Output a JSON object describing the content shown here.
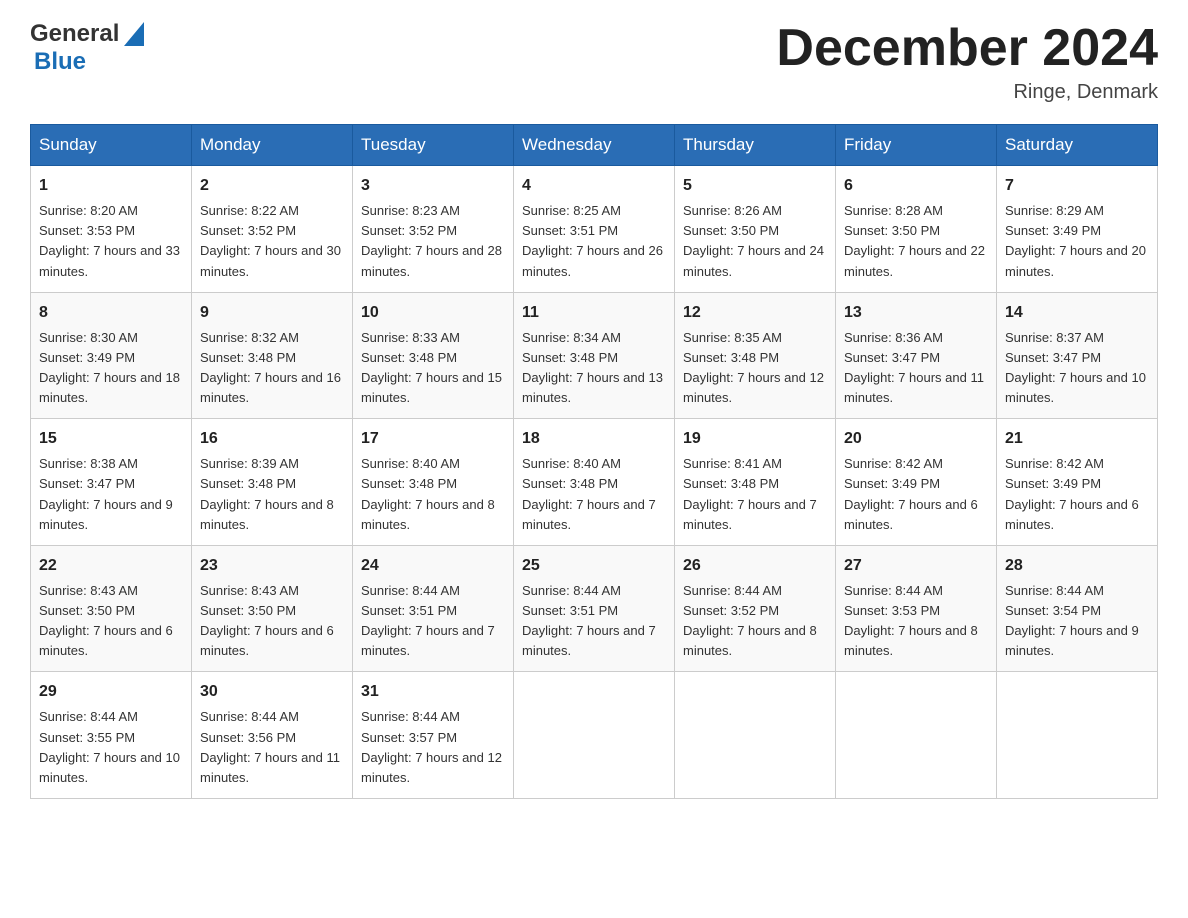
{
  "logo": {
    "text_general": "General",
    "text_blue": "Blue",
    "triangle_symbol": "▲"
  },
  "header": {
    "month_year": "December 2024",
    "location": "Ringe, Denmark"
  },
  "days_of_week": [
    "Sunday",
    "Monday",
    "Tuesday",
    "Wednesday",
    "Thursday",
    "Friday",
    "Saturday"
  ],
  "weeks": [
    [
      {
        "day": "1",
        "sunrise": "8:20 AM",
        "sunset": "3:53 PM",
        "daylight": "7 hours and 33 minutes."
      },
      {
        "day": "2",
        "sunrise": "8:22 AM",
        "sunset": "3:52 PM",
        "daylight": "7 hours and 30 minutes."
      },
      {
        "day": "3",
        "sunrise": "8:23 AM",
        "sunset": "3:52 PM",
        "daylight": "7 hours and 28 minutes."
      },
      {
        "day": "4",
        "sunrise": "8:25 AM",
        "sunset": "3:51 PM",
        "daylight": "7 hours and 26 minutes."
      },
      {
        "day": "5",
        "sunrise": "8:26 AM",
        "sunset": "3:50 PM",
        "daylight": "7 hours and 24 minutes."
      },
      {
        "day": "6",
        "sunrise": "8:28 AM",
        "sunset": "3:50 PM",
        "daylight": "7 hours and 22 minutes."
      },
      {
        "day": "7",
        "sunrise": "8:29 AM",
        "sunset": "3:49 PM",
        "daylight": "7 hours and 20 minutes."
      }
    ],
    [
      {
        "day": "8",
        "sunrise": "8:30 AM",
        "sunset": "3:49 PM",
        "daylight": "7 hours and 18 minutes."
      },
      {
        "day": "9",
        "sunrise": "8:32 AM",
        "sunset": "3:48 PM",
        "daylight": "7 hours and 16 minutes."
      },
      {
        "day": "10",
        "sunrise": "8:33 AM",
        "sunset": "3:48 PM",
        "daylight": "7 hours and 15 minutes."
      },
      {
        "day": "11",
        "sunrise": "8:34 AM",
        "sunset": "3:48 PM",
        "daylight": "7 hours and 13 minutes."
      },
      {
        "day": "12",
        "sunrise": "8:35 AM",
        "sunset": "3:48 PM",
        "daylight": "7 hours and 12 minutes."
      },
      {
        "day": "13",
        "sunrise": "8:36 AM",
        "sunset": "3:47 PM",
        "daylight": "7 hours and 11 minutes."
      },
      {
        "day": "14",
        "sunrise": "8:37 AM",
        "sunset": "3:47 PM",
        "daylight": "7 hours and 10 minutes."
      }
    ],
    [
      {
        "day": "15",
        "sunrise": "8:38 AM",
        "sunset": "3:47 PM",
        "daylight": "7 hours and 9 minutes."
      },
      {
        "day": "16",
        "sunrise": "8:39 AM",
        "sunset": "3:48 PM",
        "daylight": "7 hours and 8 minutes."
      },
      {
        "day": "17",
        "sunrise": "8:40 AM",
        "sunset": "3:48 PM",
        "daylight": "7 hours and 8 minutes."
      },
      {
        "day": "18",
        "sunrise": "8:40 AM",
        "sunset": "3:48 PM",
        "daylight": "7 hours and 7 minutes."
      },
      {
        "day": "19",
        "sunrise": "8:41 AM",
        "sunset": "3:48 PM",
        "daylight": "7 hours and 7 minutes."
      },
      {
        "day": "20",
        "sunrise": "8:42 AM",
        "sunset": "3:49 PM",
        "daylight": "7 hours and 6 minutes."
      },
      {
        "day": "21",
        "sunrise": "8:42 AM",
        "sunset": "3:49 PM",
        "daylight": "7 hours and 6 minutes."
      }
    ],
    [
      {
        "day": "22",
        "sunrise": "8:43 AM",
        "sunset": "3:50 PM",
        "daylight": "7 hours and 6 minutes."
      },
      {
        "day": "23",
        "sunrise": "8:43 AM",
        "sunset": "3:50 PM",
        "daylight": "7 hours and 6 minutes."
      },
      {
        "day": "24",
        "sunrise": "8:44 AM",
        "sunset": "3:51 PM",
        "daylight": "7 hours and 7 minutes."
      },
      {
        "day": "25",
        "sunrise": "8:44 AM",
        "sunset": "3:51 PM",
        "daylight": "7 hours and 7 minutes."
      },
      {
        "day": "26",
        "sunrise": "8:44 AM",
        "sunset": "3:52 PM",
        "daylight": "7 hours and 8 minutes."
      },
      {
        "day": "27",
        "sunrise": "8:44 AM",
        "sunset": "3:53 PM",
        "daylight": "7 hours and 8 minutes."
      },
      {
        "day": "28",
        "sunrise": "8:44 AM",
        "sunset": "3:54 PM",
        "daylight": "7 hours and 9 minutes."
      }
    ],
    [
      {
        "day": "29",
        "sunrise": "8:44 AM",
        "sunset": "3:55 PM",
        "daylight": "7 hours and 10 minutes."
      },
      {
        "day": "30",
        "sunrise": "8:44 AM",
        "sunset": "3:56 PM",
        "daylight": "7 hours and 11 minutes."
      },
      {
        "day": "31",
        "sunrise": "8:44 AM",
        "sunset": "3:57 PM",
        "daylight": "7 hours and 12 minutes."
      },
      null,
      null,
      null,
      null
    ]
  ]
}
